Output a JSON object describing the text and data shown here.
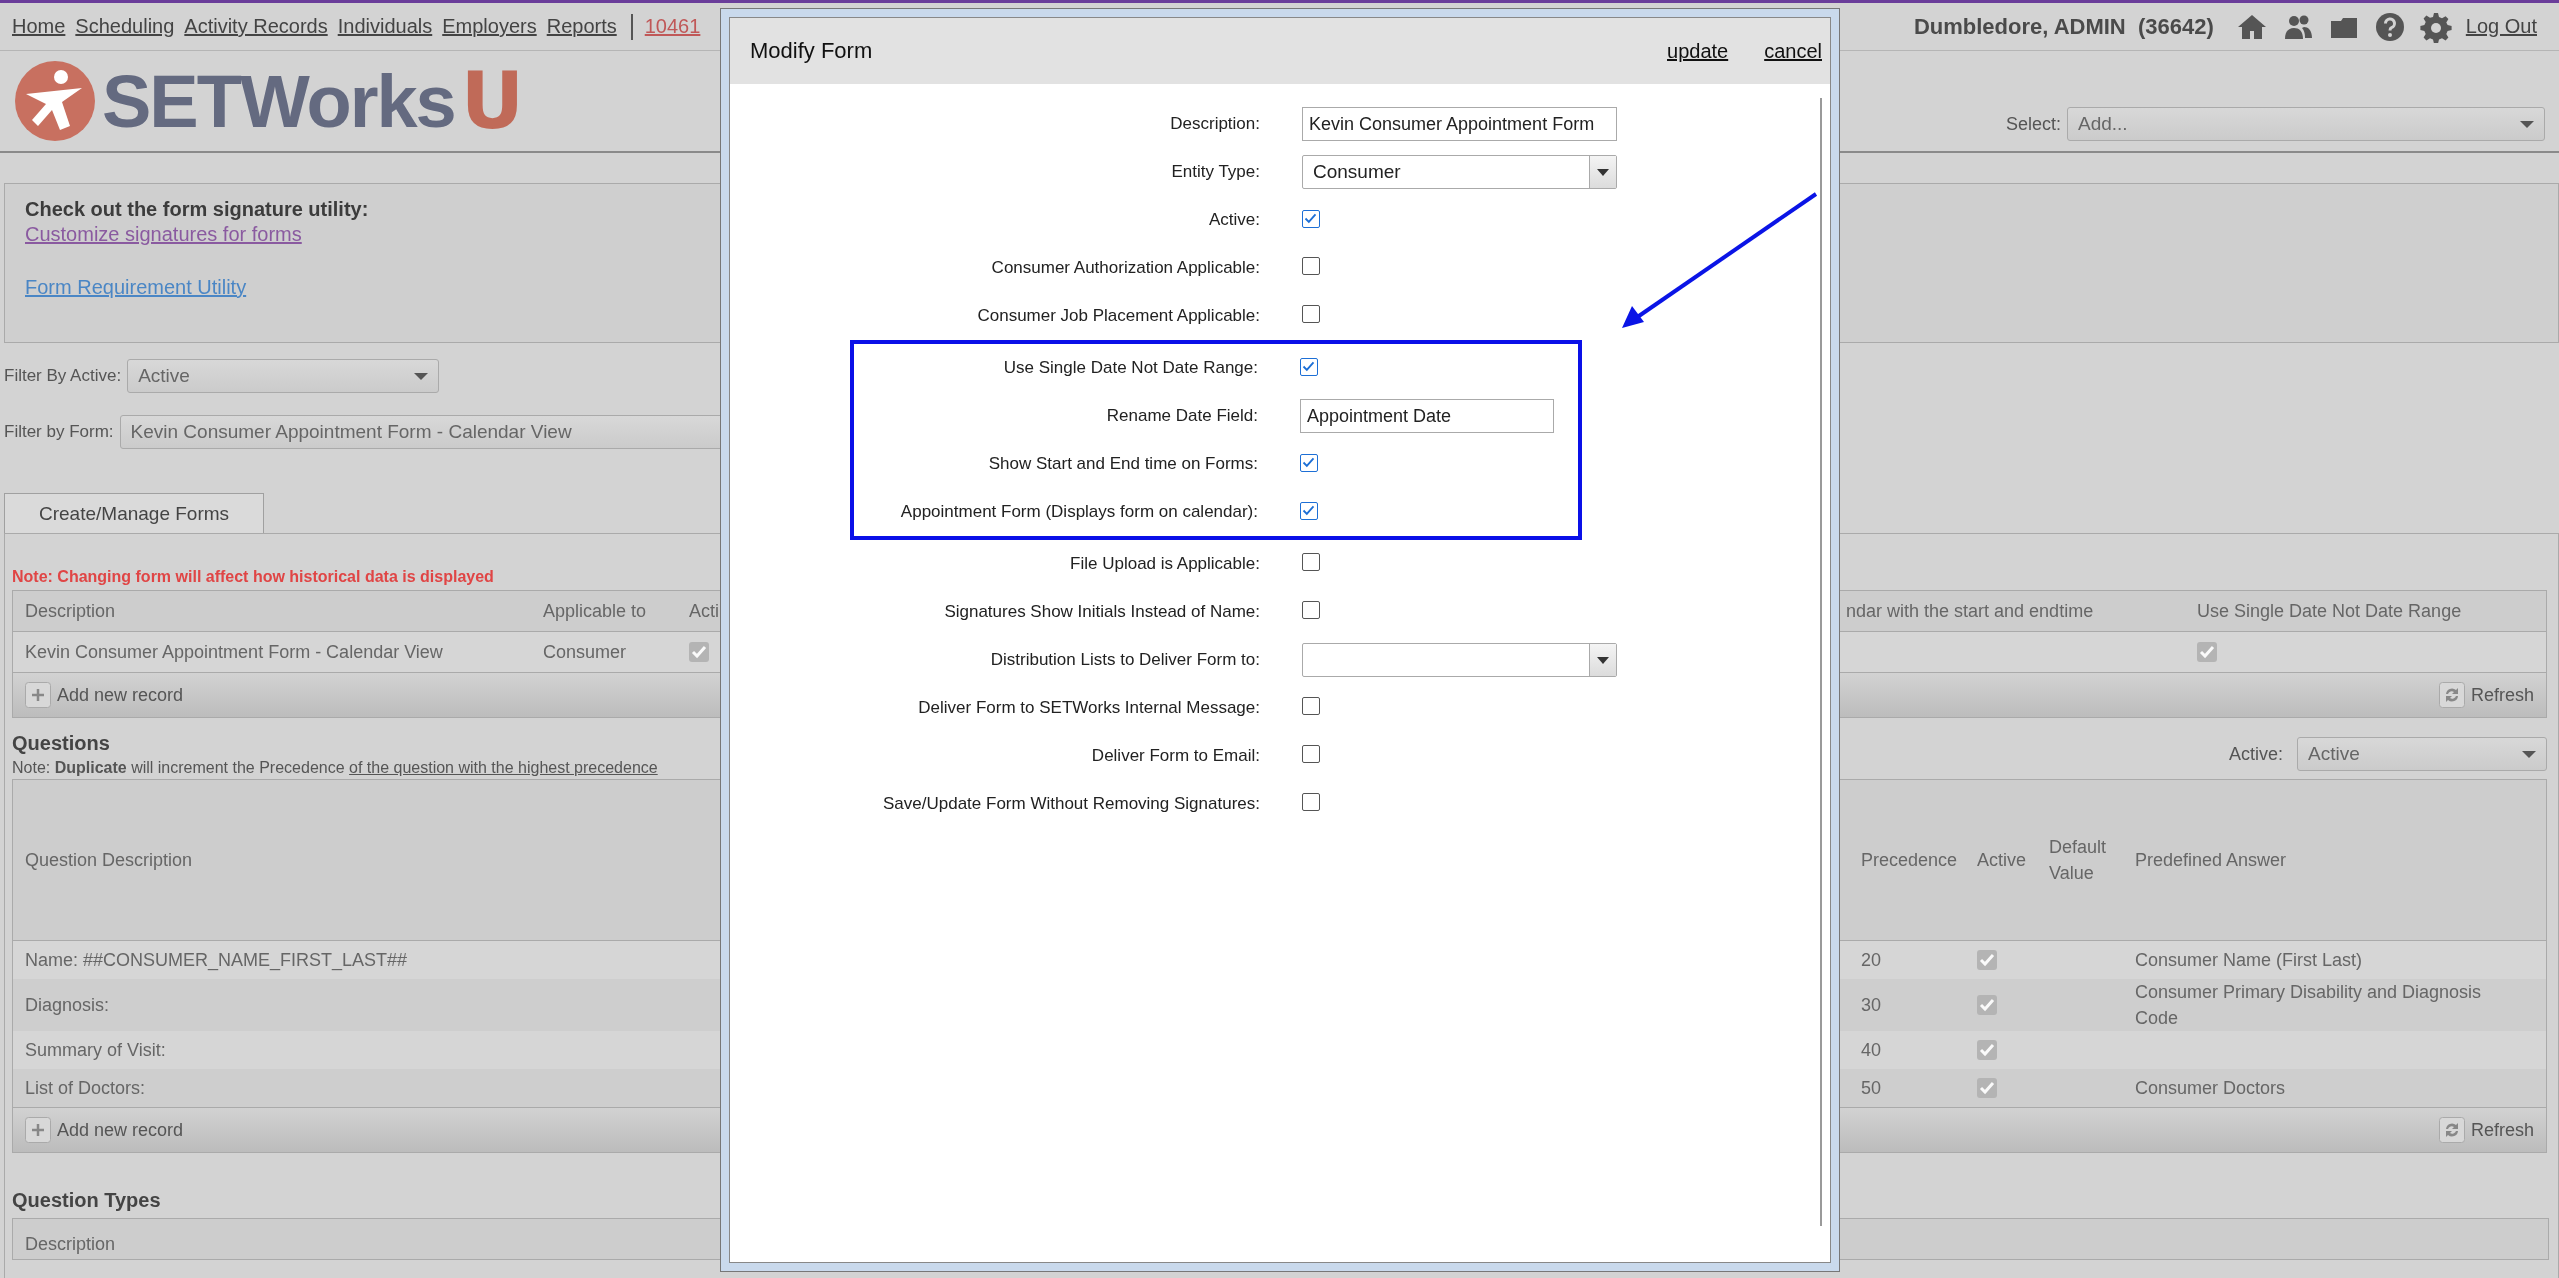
{
  "nav": {
    "links": [
      "Home",
      "Scheduling",
      "Activity Records",
      "Individuals",
      "Employers",
      "Reports"
    ],
    "record_link": "10461"
  },
  "user": {
    "name": "Dumbledore, ADMIN",
    "id": "(36642)",
    "logout": "Log Out"
  },
  "logo": {
    "name": "SETWorks",
    "suffix": "U"
  },
  "select": {
    "label": "Select:",
    "value": "Add..."
  },
  "info": {
    "heading": "Check out the form signature utility:",
    "links": [
      {
        "label": "Customize signatures for forms",
        "visited": true
      },
      {
        "label": "Form Requirement Utility",
        "visited": false
      }
    ]
  },
  "filters": [
    {
      "label": "Filter By Active:",
      "value": "Active"
    },
    {
      "label": "Filter by Form:",
      "value": "Kevin Consumer Appointment Form - Calendar View"
    }
  ],
  "tabs": [
    {
      "label": "Create/Manage Forms",
      "selected": true
    }
  ],
  "forms": {
    "note": "Note: Changing form will affect how historical data is displayed",
    "columns": [
      "Description",
      "Applicable to",
      "Acti",
      "ndar with the start and endtime",
      "Use Single Date Not Date Range"
    ],
    "rows": [
      {
        "description": "Kevin Consumer Appointment Form - Calendar View",
        "applicable_to": "Consumer",
        "active": true,
        "single_date": true
      }
    ],
    "add_button": "Add new record",
    "refresh_button": "Refresh"
  },
  "questions": {
    "title": "Questions",
    "note": "Note: **Duplicate** will increment the Precedence",
    "note_link": "of the question with the highest precedence",
    "active_filter": {
      "label": "Active:",
      "value": "Active"
    },
    "columns": [
      "Question Description",
      "Precedence",
      "Active",
      "Default Value",
      "Predefined Answer"
    ],
    "rows": [
      {
        "description": "Name: ##CONSUMER_NAME_FIRST_LAST##",
        "precedence": "20",
        "active": true,
        "predefined_answer": "Consumer Name (First Last)"
      },
      {
        "description": "Diagnosis:",
        "precedence": "30",
        "active": true,
        "predefined_answer": "Consumer Primary Disability and Diagnosis Code"
      },
      {
        "description": "Summary of Visit:",
        "precedence": "40",
        "active": true
      },
      {
        "description": "List of Doctors:",
        "precedence": "50",
        "active": true,
        "predefined_answer": "Consumer Doctors"
      }
    ],
    "add_button": "Add new record",
    "refresh_button": "Refresh"
  },
  "question_types": {
    "title": "Question Types",
    "columns": [
      "Description"
    ]
  },
  "modal": {
    "title": "Modify Form",
    "actions": [
      "update",
      "cancel"
    ],
    "fields": [
      {
        "kind": "text",
        "label": "Description:",
        "value": "Kevin Consumer Appointment Form",
        "highlighted": false
      },
      {
        "kind": "select",
        "label": "Entity Type:",
        "value": "Consumer",
        "highlighted": false
      },
      {
        "kind": "checkbox",
        "label": "Active:",
        "checked": true,
        "highlighted": false
      },
      {
        "kind": "checkbox",
        "label": "Consumer Authorization Applicable:",
        "checked": false,
        "highlighted": false
      },
      {
        "kind": "checkbox",
        "label": "Consumer Job Placement Applicable:",
        "checked": false,
        "highlighted": false
      },
      {
        "kind": "checkbox",
        "label": "Use Single Date Not Date Range:",
        "checked": true,
        "highlighted": true
      },
      {
        "kind": "text",
        "label": "Rename Date Field:",
        "value": "Appointment Date",
        "highlighted": true
      },
      {
        "kind": "checkbox",
        "label": "Show Start and End time on Forms:",
        "checked": true,
        "highlighted": true
      },
      {
        "kind": "checkbox",
        "label": "Appointment Form (Displays form on calendar):",
        "checked": true,
        "highlighted": true
      },
      {
        "kind": "checkbox",
        "label": "File Upload is Applicable:",
        "checked": false,
        "highlighted": false
      },
      {
        "kind": "checkbox",
        "label": "Signatures Show Initials Instead of Name:",
        "checked": false,
        "highlighted": false
      },
      {
        "kind": "select",
        "label": "Distribution Lists to Deliver Form to:",
        "highlighted": false
      },
      {
        "kind": "checkbox",
        "label": "Deliver Form to SETWorks Internal Message:",
        "checked": false,
        "highlighted": false
      },
      {
        "kind": "checkbox",
        "label": "Deliver Form to Email:",
        "checked": false,
        "highlighted": false
      },
      {
        "kind": "checkbox",
        "label": "Save/Update Form Without Removing Signatures:",
        "checked": false,
        "highlighted": false
      }
    ]
  }
}
